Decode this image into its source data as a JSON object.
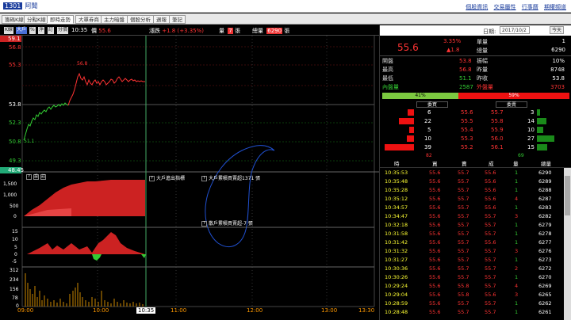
{
  "title": {
    "code": "1301",
    "name": "阿聞"
  },
  "toplinks": [
    "個股資訊",
    "交易屬性",
    "行事曆",
    "期權頻道"
  ],
  "tabs": [
    "籌碼K線",
    "分點K線",
    "即時走勢",
    "大單券商",
    "主力暗盤",
    "個股分析",
    "週報",
    "筆記"
  ],
  "toolbar": {
    "buttons": [
      "K線",
      "大戶",
      "%",
      "淨",
      "訂",
      "分價"
    ],
    "time": "10:35",
    "price_label": "價",
    "price": "55.6",
    "change_label": "漲跌",
    "change": "+1.8 (+3.35%)",
    "vol_label": "量",
    "vol": "7",
    "vol_unit": "張",
    "total_label": "總量",
    "total": "6290",
    "total_unit": "張"
  },
  "yaxis": {
    "top": "59.1",
    "levels": [
      "56.8",
      "55.3",
      "53.8",
      "52.3",
      "50.8",
      "49.3"
    ],
    "bottom": "48.45",
    "peak": "56.8",
    "open": "51.1"
  },
  "panels": {
    "p1_label": "大戶進出指標",
    "p1_ticks": [
      "1,500",
      "1,000",
      "500",
      "0"
    ],
    "p2_label": "大戶累積買賣超1371 張",
    "p3_label": "散戶累積買賣超-7 張",
    "p3_ticks": [
      "15",
      "10",
      "5",
      "0",
      "-5"
    ],
    "vol_ticks": [
      "312",
      "234",
      "156",
      "78",
      "0"
    ],
    "p1_box": "?",
    "p1_box2": "?",
    "p1_box3": "?"
  },
  "xaxis": [
    "09:00",
    "10:00",
    "10:35",
    "11:00",
    "12:00",
    "13:00",
    "13:30"
  ],
  "quote": {
    "price": "55.6",
    "pct": "3.35%",
    "chg": "▲1.8",
    "single": "單量",
    "single_v": "1",
    "total": "總量",
    "total_v": "6290"
  },
  "stats": [
    {
      "l": "開盤",
      "v": "53.8",
      "l2": "振幅",
      "v2": "10%"
    },
    {
      "l": "最高",
      "v": "56.8",
      "l2": "昨量",
      "v2": "8748"
    },
    {
      "l": "最低",
      "v": "51.1",
      "l2": "昨收",
      "v2": "53.8"
    },
    {
      "l": "內盤量",
      "v": "2587",
      "l2": "外盤量",
      "v2": "3703"
    }
  ],
  "ratio": {
    "buy": "41%",
    "sell": "59%"
  },
  "orderbook_hdr": {
    "buy": "委買",
    "sell": "委賣"
  },
  "orderbook": [
    {
      "bq": "6",
      "bp": "55.6",
      "sp": "55.7",
      "sq": "3"
    },
    {
      "bq": "22",
      "bp": "55.5",
      "sp": "55.8",
      "sq": "14"
    },
    {
      "bq": "5",
      "bp": "55.4",
      "sp": "55.9",
      "sq": "10"
    },
    {
      "bq": "10",
      "bp": "55.3",
      "sp": "56.0",
      "sq": "27"
    },
    {
      "bq": "39",
      "bp": "55.2",
      "sp": "56.1",
      "sq": "15"
    }
  ],
  "ob_totals": {
    "buy": "82",
    "sell": "69"
  },
  "tick_hdr": [
    "時",
    "買",
    "賣",
    "成",
    "量",
    "總量"
  ],
  "ticks": [
    {
      "t": "10:35:53",
      "b": "55.6",
      "s": "55.7",
      "p": "55.6",
      "q": "1",
      "tot": "6290"
    },
    {
      "t": "10:35:48",
      "b": "55.6",
      "s": "55.7",
      "p": "55.6",
      "q": "1",
      "tot": "6289"
    },
    {
      "t": "10:35:28",
      "b": "55.6",
      "s": "55.7",
      "p": "55.6",
      "q": "1",
      "tot": "6288"
    },
    {
      "t": "10:35:12",
      "b": "55.6",
      "s": "55.7",
      "p": "55.6",
      "q": "4",
      "tot": "6287"
    },
    {
      "t": "10:34:57",
      "b": "55.6",
      "s": "55.7",
      "p": "55.6",
      "q": "1",
      "tot": "6283"
    },
    {
      "t": "10:34:47",
      "b": "55.6",
      "s": "55.7",
      "p": "55.7",
      "q": "3",
      "tot": "6282"
    },
    {
      "t": "10:32:18",
      "b": "55.6",
      "s": "55.7",
      "p": "55.7",
      "q": "1",
      "tot": "6279"
    },
    {
      "t": "10:31:58",
      "b": "55.6",
      "s": "55.7",
      "p": "55.7",
      "q": "1",
      "tot": "6278"
    },
    {
      "t": "10:31:42",
      "b": "55.6",
      "s": "55.7",
      "p": "55.6",
      "q": "1",
      "tot": "6277"
    },
    {
      "t": "10:31:32",
      "b": "55.6",
      "s": "55.7",
      "p": "55.7",
      "q": "3",
      "tot": "6276"
    },
    {
      "t": "10:31:27",
      "b": "55.6",
      "s": "55.7",
      "p": "55.7",
      "q": "1",
      "tot": "6273"
    },
    {
      "t": "10:30:36",
      "b": "55.6",
      "s": "55.7",
      "p": "55.7",
      "q": "2",
      "tot": "6272"
    },
    {
      "t": "10:30:26",
      "b": "55.6",
      "s": "55.7",
      "p": "55.7",
      "q": "1",
      "tot": "6270"
    },
    {
      "t": "10:29:24",
      "b": "55.6",
      "s": "55.8",
      "p": "55.7",
      "q": "4",
      "tot": "6269"
    },
    {
      "t": "10:29:04",
      "b": "55.6",
      "s": "55.8",
      "p": "55.6",
      "q": "3",
      "tot": "6265"
    },
    {
      "t": "10:28:59",
      "b": "55.6",
      "s": "55.7",
      "p": "55.7",
      "q": "1",
      "tot": "6262"
    },
    {
      "t": "10:28:48",
      "b": "55.6",
      "s": "55.7",
      "p": "55.7",
      "q": "1",
      "tot": "6261"
    }
  ],
  "date": {
    "label": "日期:",
    "value": "2017/10/2",
    "today": "今天"
  },
  "colors": {
    "up": "#ff3333",
    "down": "#33cc33",
    "bg": "#000000"
  }
}
